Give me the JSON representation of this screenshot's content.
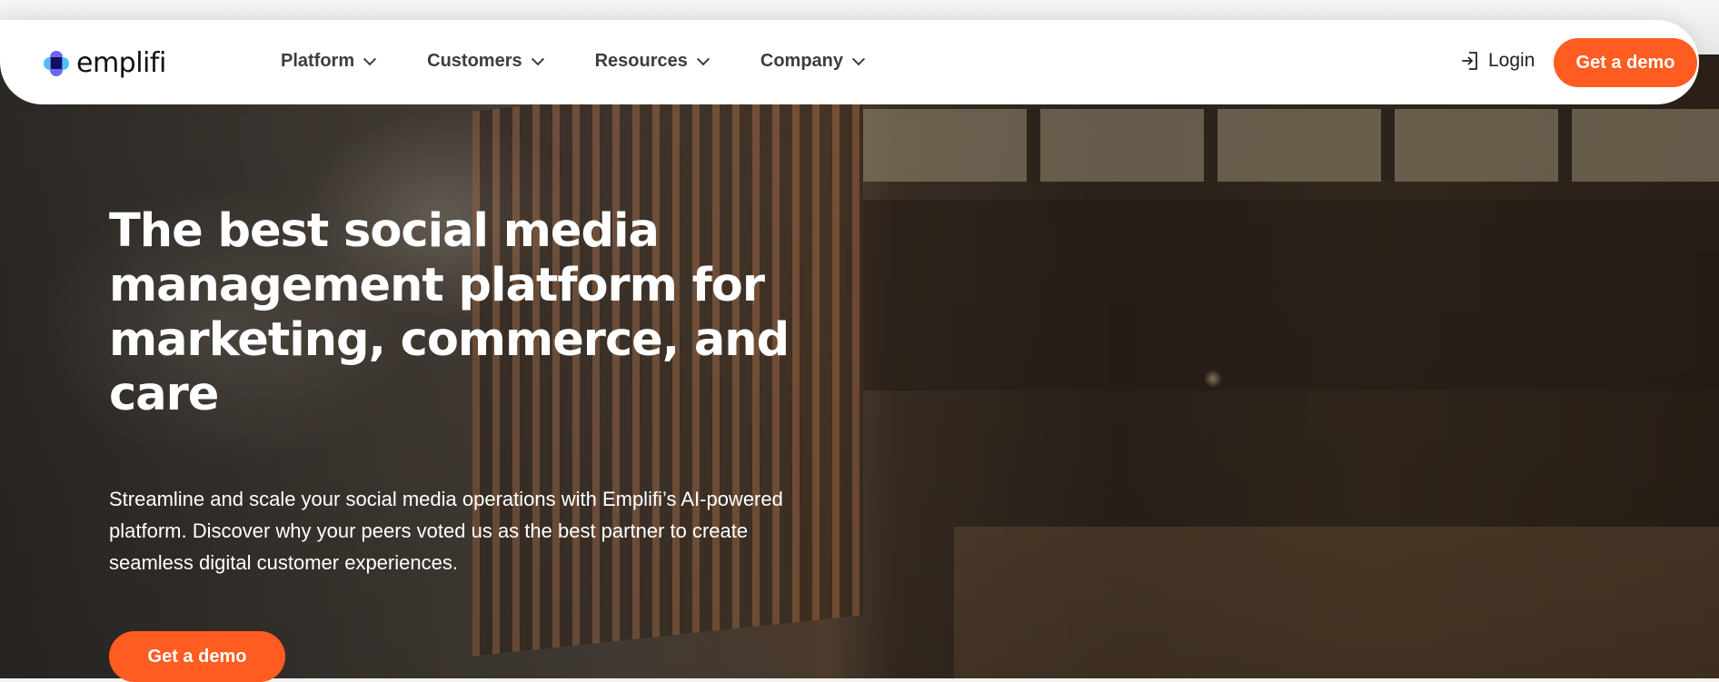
{
  "brand": {
    "name": "emplifi",
    "colors": {
      "accent": "#ff5c21",
      "logo_light_blue": "#4cc2f1",
      "logo_purple": "#6b67f3",
      "logo_navy": "#0f0f5e"
    }
  },
  "nav": {
    "menu": [
      {
        "label": "Platform",
        "icon": "chevron-down-icon"
      },
      {
        "label": "Customers",
        "icon": "chevron-down-icon"
      },
      {
        "label": "Resources",
        "icon": "chevron-down-icon"
      },
      {
        "label": "Company",
        "icon": "chevron-down-icon"
      }
    ],
    "login_label": "Login",
    "login_icon": "login-icon",
    "demo_label": "Get a demo"
  },
  "hero": {
    "headline": "The best social media management platform for marketing, commerce, and care",
    "subtext": "Streamline and scale your social media operations with Emplifi’s AI-powered platform. Discover why your peers voted us as the best partner to create seamless digital customer experiences.",
    "cta_label": "Get a demo"
  }
}
